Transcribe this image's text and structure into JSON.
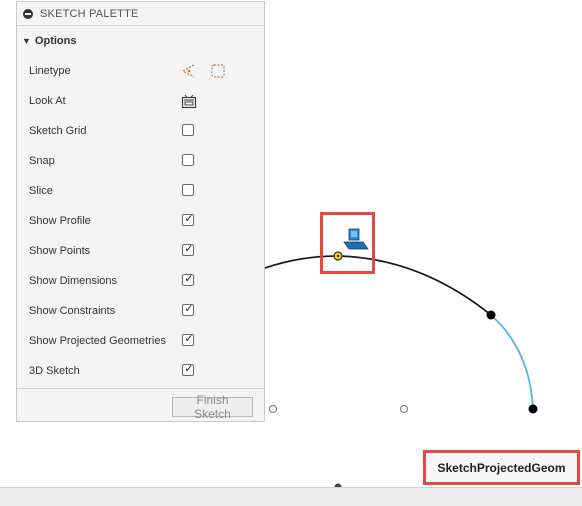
{
  "palette": {
    "title": "SKETCH PALETTE",
    "section_title": "Options",
    "rows": [
      {
        "label": "Linetype",
        "type": "icons"
      },
      {
        "label": "Look At",
        "type": "icon"
      },
      {
        "label": "Sketch Grid",
        "checked": false
      },
      {
        "label": "Snap",
        "checked": false
      },
      {
        "label": "Slice",
        "checked": false
      },
      {
        "label": "Show Profile",
        "checked": true
      },
      {
        "label": "Show Points",
        "checked": true
      },
      {
        "label": "Show Dimensions",
        "checked": true
      },
      {
        "label": "Show Constraints",
        "checked": true
      },
      {
        "label": "Show Projected Geometries",
        "checked": true
      },
      {
        "label": "3D Sketch",
        "checked": true
      }
    ],
    "finish_button": "Finish Sketch"
  },
  "canvas": {
    "tooltip_label": "SketchProjectedGeom",
    "colors": {
      "sketch_line": "#1a1a1a",
      "projected_line": "#5ab4e0",
      "highlight": "#e14a43",
      "point": "#000000",
      "constraint_marker": "#f2d11a"
    },
    "icons": [
      "linetype-icon",
      "construction-icon",
      "look-at-icon",
      "projected-geometry-icon"
    ]
  },
  "check_glyph": "✓"
}
